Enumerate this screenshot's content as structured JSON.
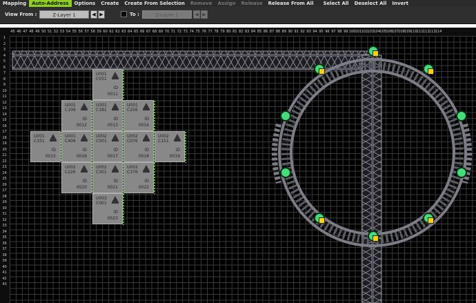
{
  "menu": {
    "items": [
      {
        "label": "Mapping",
        "state": "normal"
      },
      {
        "label": "Auto-Address",
        "state": "active"
      },
      {
        "label": "Options",
        "state": "normal"
      },
      {
        "label": "Create",
        "state": "normal"
      },
      {
        "label": "Create From Selection",
        "state": "normal"
      },
      {
        "label": "Remove",
        "state": "disabled"
      },
      {
        "label": "Assign",
        "state": "disabled"
      },
      {
        "label": "Release",
        "state": "disabled"
      },
      {
        "label": "Release From All",
        "state": "normal"
      },
      {
        "label": "Select All",
        "state": "normal"
      },
      {
        "label": "Deselect All",
        "state": "normal"
      },
      {
        "label": "Invert",
        "state": "normal"
      }
    ]
  },
  "toolbar": {
    "view_from_label": "View From :",
    "view_from_value": "Z-Layer 1",
    "to_label": "To :",
    "to_value": "Z-Layer 1"
  },
  "grid": {
    "col_start": 45,
    "col_end": 114,
    "row_start": 1,
    "row_end": 43
  },
  "fixtures": [
    {
      "u": "U001",
      "c": "C031",
      "id": "0011"
    },
    {
      "u": "U001",
      "c": "C106",
      "id": "0012"
    },
    {
      "u": "U001",
      "c": "C181",
      "id": "0013"
    },
    {
      "u": "U001",
      "c": "C256",
      "id": "0014"
    },
    {
      "u": "U001",
      "c": "C331",
      "id": "0015"
    },
    {
      "u": "U001",
      "c": "C406",
      "id": "0016"
    },
    {
      "u": "U002",
      "c": "C001",
      "id": "0017"
    },
    {
      "u": "U002",
      "c": "C076",
      "id": "0018"
    },
    {
      "u": "U002",
      "c": "C151",
      "id": "0019"
    },
    {
      "u": "U002",
      "c": "C226",
      "id": "0020"
    },
    {
      "u": "U002",
      "c": "C301",
      "id": "0021"
    },
    {
      "u": "U002",
      "c": "C376",
      "id": "0022"
    },
    {
      "u": "U003",
      "c": "C001",
      "id": "0023"
    }
  ],
  "id_label": "ID",
  "colors": {
    "accent": "#8fcf1f",
    "led": "#3fe07a",
    "selected": "#ffd200"
  }
}
